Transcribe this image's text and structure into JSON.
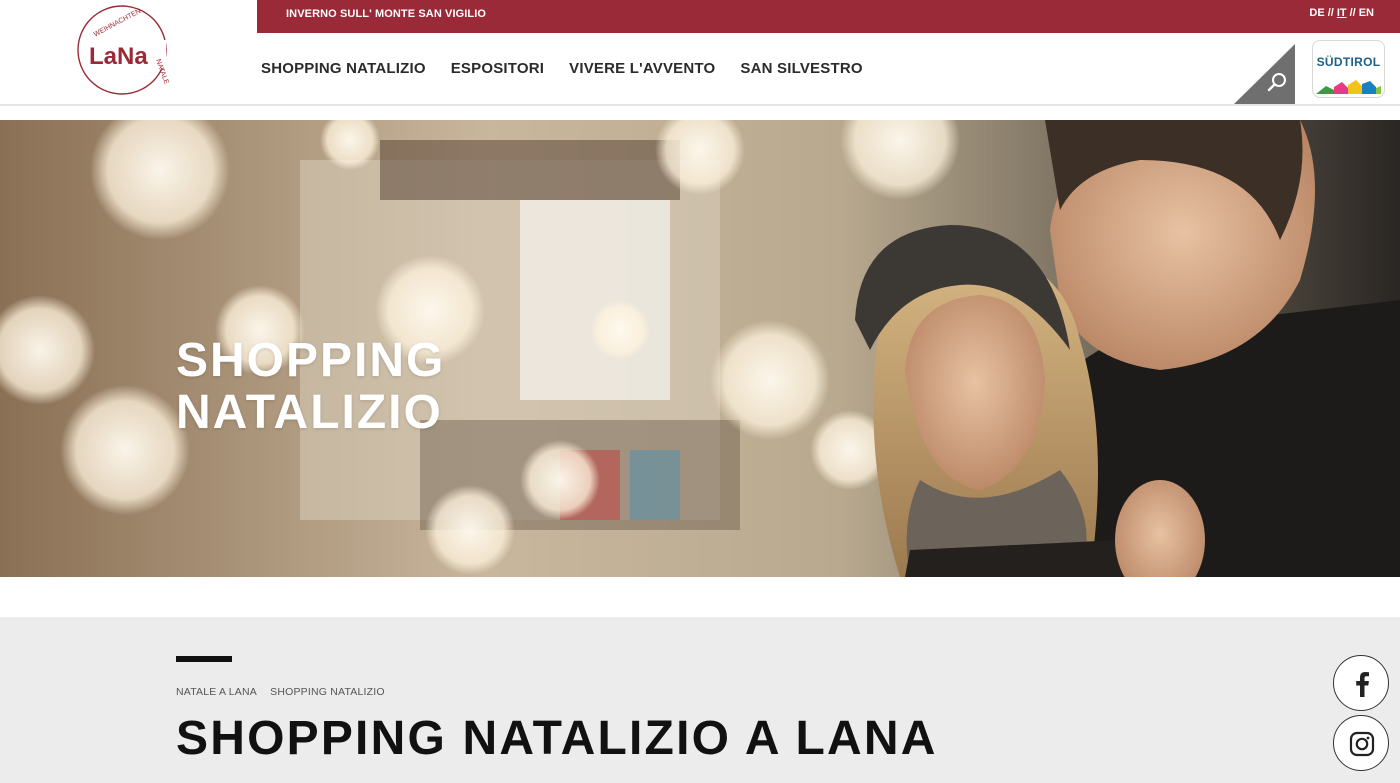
{
  "logo": {
    "wordmark": "LaNa",
    "arc_top": "WEIHNACHTEN",
    "arc_right": "NATALE"
  },
  "topbar": {
    "link": "INVERNO SULL' MONTE SAN VIGILIO",
    "languages": [
      "DE",
      "IT",
      "EN"
    ],
    "separator": "//",
    "active_language": "IT"
  },
  "nav": {
    "items": [
      "SHOPPING NATALIZIO",
      "ESPOSITORI",
      "VIVERE L'AVVENTO",
      "SAN SILVESTRO"
    ]
  },
  "brand": {
    "name": "SÜDTIROL"
  },
  "hero": {
    "title_line1": "SHOPPING",
    "title_line2": "NATALIZIO"
  },
  "breadcrumb": [
    "NATALE A LANA",
    "SHOPPING NATALIZIO"
  ],
  "page_title": "SHOPPING NATALIZIO A LANA",
  "icons": {
    "search": "search-icon",
    "facebook": "facebook-icon",
    "instagram": "instagram-icon"
  },
  "colors": {
    "brand_red": "#9a2a37",
    "search_gray": "#6f6f6f",
    "content_bg": "#ececec",
    "text_dark": "#111111"
  }
}
